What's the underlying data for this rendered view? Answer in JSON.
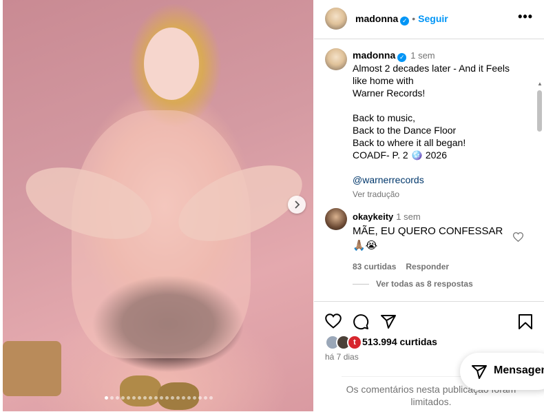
{
  "post": {
    "carousel": {
      "slide_count": 20,
      "active_slide": 1
    }
  },
  "header": {
    "username": "madonna",
    "separator": "•",
    "follow_label": "Seguir",
    "more_label": "•••"
  },
  "caption": {
    "username": "madonna",
    "time": "1 sem",
    "lines": [
      "Almost 2 decades later - And it Feels",
      "like  home with",
      "Warner Records!",
      "",
      "Back to music,",
      "Back to the Dance Floor",
      "Back to where it all began!",
      "COADF- P. 2 🪩 2026"
    ],
    "mention": "@warnerrecords",
    "translate_label": "Ver tradução"
  },
  "comment": {
    "username": "okaykeity",
    "time": "1 sem",
    "text": "MÃE, EU QUERO CONFESSAR",
    "emoji": "🙏🏽😭",
    "likes": "83 curtidas",
    "reply_label": "Responder",
    "view_replies": "Ver todas as 8 respostas"
  },
  "actions": {
    "likes": "513.994 curtidas",
    "posted_ago": "há 7 dias",
    "comments_limited": "Os comentários nesta publicação foram limitados."
  },
  "messages_button": {
    "label": "Mensagens"
  }
}
